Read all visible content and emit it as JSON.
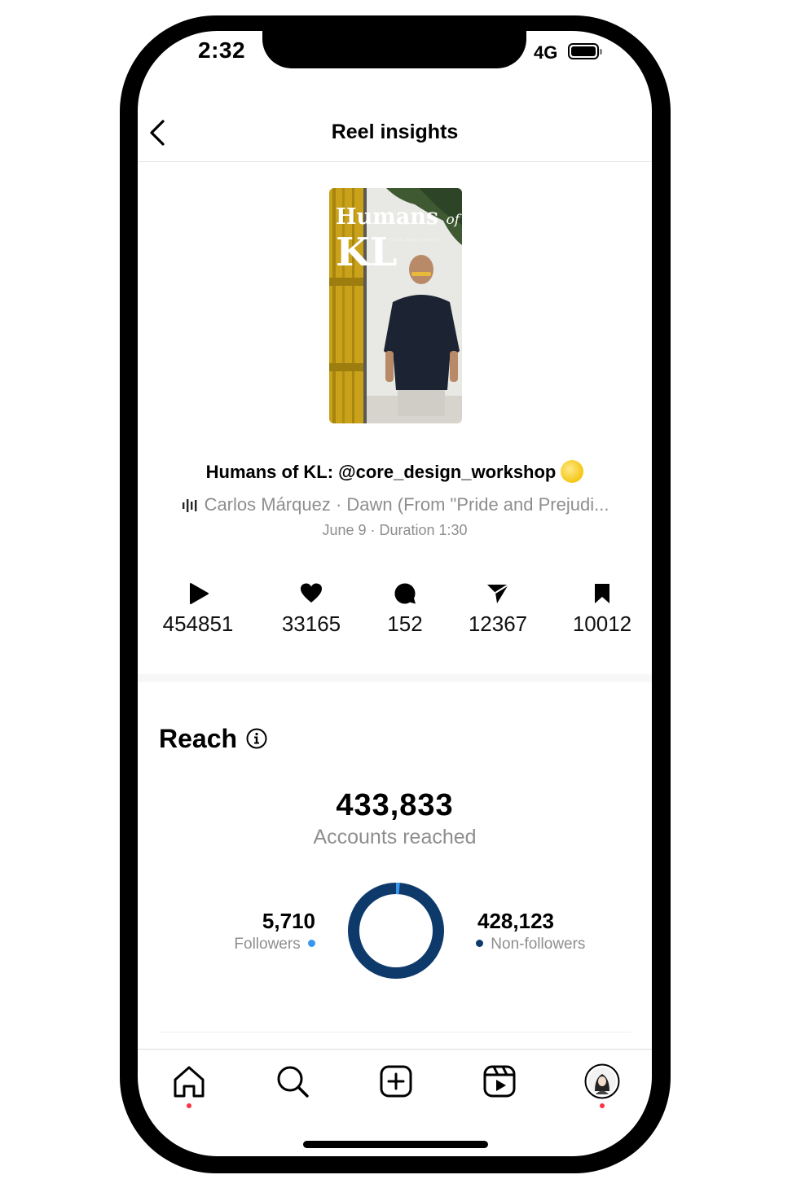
{
  "status_bar": {
    "time": "2:32",
    "network": "4G"
  },
  "header": {
    "title": "Reel insights"
  },
  "thumbnail": {
    "title_line1": "Humans",
    "title_of": "of",
    "title_line2": "KL",
    "handle": "@core_design_workshop"
  },
  "reel": {
    "caption": "Humans of KL: @core_design_workshop",
    "audio": "Carlos Márquez · Dawn (From \"Pride and Prejudi...",
    "meta": "June 9 · Duration 1:30"
  },
  "stats": {
    "plays": "454851",
    "likes": "33165",
    "comments": "152",
    "shares": "12367",
    "saves": "10012"
  },
  "reach": {
    "title": "Reach",
    "total": "433,833",
    "total_label": "Accounts reached",
    "followers_value": "5,710",
    "followers_label": "Followers",
    "nonfollowers_value": "428,123",
    "nonfollowers_label": "Non-followers",
    "followers_fraction": 0.013,
    "colors": {
      "followers": "#3897f0",
      "nonfollowers": "#0d3a6b"
    }
  },
  "nav": {
    "items": [
      "home-icon",
      "search-icon",
      "create-icon",
      "reels-icon",
      "profile-avatar"
    ]
  }
}
